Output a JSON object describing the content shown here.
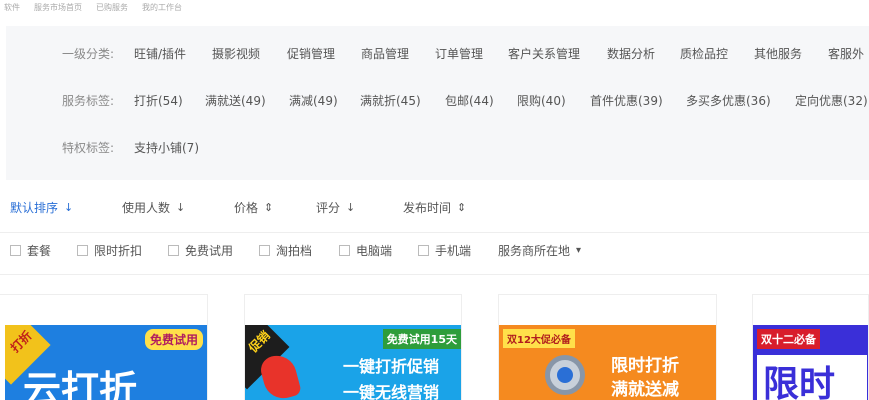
{
  "topbar": {
    "items": [
      "软件",
      "服务市场首页",
      "已购服务",
      "我的工作台"
    ]
  },
  "filters": {
    "row1": {
      "label": "一级分类:",
      "items": [
        "旺铺/插件",
        "摄影视频",
        "促销管理",
        "商品管理",
        "订单管理",
        "客户关系管理",
        "数据分析",
        "质检品控",
        "其他服务",
        "客服外"
      ]
    },
    "row2": {
      "label": "服务标签:",
      "items": [
        "打折(54)",
        "满就送(49)",
        "满减(49)",
        "满就折(45)",
        "包邮(44)",
        "限购(40)",
        "首件优惠(39)",
        "多买多优惠(36)",
        "定向优惠(32)"
      ]
    },
    "row3": {
      "label": "特权标签:",
      "items": [
        "支持小铺(7)"
      ]
    }
  },
  "sort": {
    "items": [
      {
        "label": "默认排序",
        "icon": "↓",
        "active": true
      },
      {
        "label": "使用人数",
        "icon": "↓",
        "active": false
      },
      {
        "label": "价格",
        "icon": "⇕",
        "active": false
      },
      {
        "label": "评分",
        "icon": "↓",
        "active": false
      },
      {
        "label": "发布时间",
        "icon": "⇕",
        "active": false
      }
    ]
  },
  "checks": {
    "items": [
      "套餐",
      "限时折扣",
      "免费试用",
      "淘拍档",
      "电脑端",
      "手机端"
    ],
    "location_label": "服务商所在地",
    "location_icon": "▾"
  },
  "cards": [
    {
      "corner": "打折",
      "badge": "免费试用",
      "big": "云打折",
      "bg": "#1e7fe0"
    },
    {
      "corner": "促销",
      "badge": "免费试用15天",
      "line1": "一键打折促销",
      "line2": "一键无线营销",
      "bg": "#1aa3e8"
    },
    {
      "badge": "双12大促必备",
      "line1": "限时打折",
      "line2": "满就送减",
      "bg": "#f58a1f"
    },
    {
      "badge": "双十二必备",
      "big": "限时",
      "bg": "#3a2fd8"
    }
  ],
  "colors": {
    "accent": "#2a6fd6",
    "filter_bg": "#f6f7f9"
  }
}
